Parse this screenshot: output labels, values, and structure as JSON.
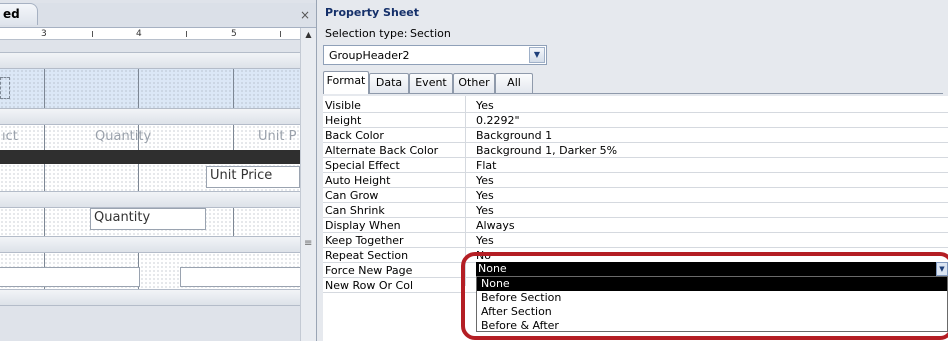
{
  "designer": {
    "tab_title": "ed",
    "close_glyph": "×",
    "ruler": {
      "marks": [
        "3",
        "4",
        "5"
      ]
    },
    "labels": {
      "product_partial": "ıct",
      "quantity_header": "Quantity",
      "unit_price_header": "Unit P",
      "unit_price_box": "Unit Price",
      "quantity_box": "Quantity"
    }
  },
  "property_sheet": {
    "title": "Property Sheet",
    "selection_type_label": "Selection type:",
    "selection_type_value": "Section",
    "object_combo": {
      "value": "GroupHeader2"
    },
    "tabs": [
      "Format",
      "Data",
      "Event",
      "Other",
      "All"
    ],
    "active_tab": "Format",
    "properties": [
      {
        "name": "Visible",
        "value": "Yes"
      },
      {
        "name": "Height",
        "value": "0.2292\""
      },
      {
        "name": "Back Color",
        "value": "Background 1"
      },
      {
        "name": "Alternate Back Color",
        "value": "Background 1, Darker 5%"
      },
      {
        "name": "Special Effect",
        "value": "Flat"
      },
      {
        "name": "Auto Height",
        "value": "Yes"
      },
      {
        "name": "Can Grow",
        "value": "Yes"
      },
      {
        "name": "Can Shrink",
        "value": "Yes"
      },
      {
        "name": "Display When",
        "value": "Always"
      },
      {
        "name": "Keep Together",
        "value": "Yes"
      },
      {
        "name": "Repeat Section",
        "value": "No"
      },
      {
        "name": "Force New Page",
        "value": "None"
      },
      {
        "name": "New Row Or Col",
        "value": ""
      }
    ],
    "dropdown": {
      "current": "None",
      "options": [
        "None",
        "Before Section",
        "After Section",
        "Before & After"
      ],
      "selected": "None"
    }
  },
  "colors": {
    "highlight_border": "#b41e24",
    "title_blue": "#15306a",
    "selected_bg": "#000000"
  }
}
